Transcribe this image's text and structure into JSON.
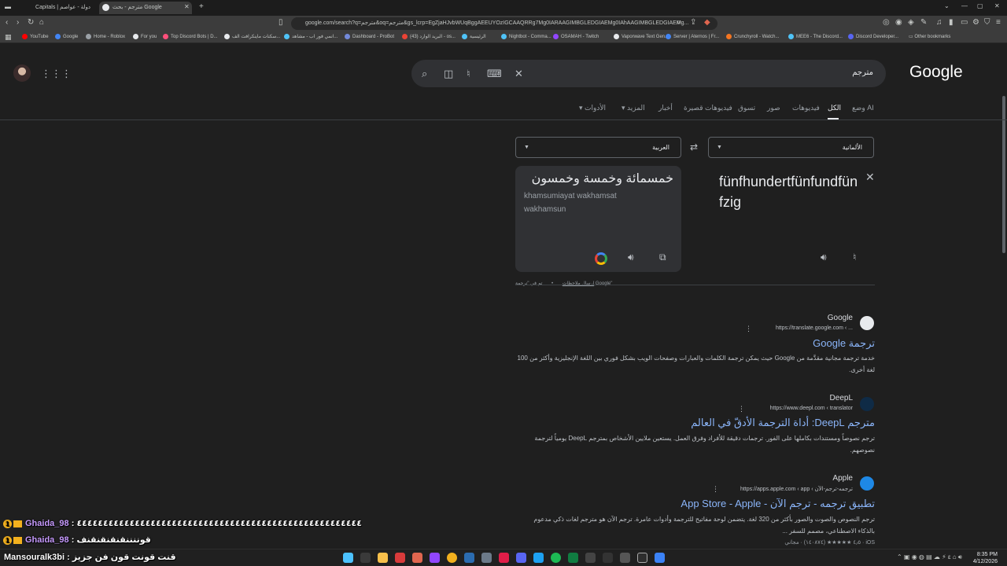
{
  "browser": {
    "tabs": [
      {
        "label": "Capitals | دولة - عواصم",
        "active": false
      },
      {
        "label": "مترجم - بحث Google",
        "active": true
      }
    ],
    "url": "google.com/search?q=مترجم&oq=مترجم&gs_lcrp=EgZjaHJvbWUqBggAEEUYOzIGCAAQRRg7Mg0IARAAGIMBGLEDGIAEMg0IAhAAGIMBGLEDGIAEMg...",
    "bookmarks": [
      {
        "label": "YouTube",
        "color": "#ff0000"
      },
      {
        "label": "Google",
        "color": "#4285f4"
      },
      {
        "label": "Home - Roblox",
        "color": "#9aa0a6"
      },
      {
        "label": "For you",
        "color": "#e8eaed"
      },
      {
        "label": "Top Discord Bots | D...",
        "color": "#ff4f7b"
      },
      {
        "label": "سكنات ماينكرافت الف...",
        "color": "#e8eaed"
      },
      {
        "label": "انمي فور اب - مشاهد...",
        "color": "#4fc3f7"
      },
      {
        "label": "Dashboard - ProBot",
        "color": "#7289da"
      },
      {
        "label": "(43) البريد الوارد - os...",
        "color": "#ea4335"
      },
      {
        "label": "الرئيسية",
        "color": "#4fc3f7"
      },
      {
        "label": "Nightbot - Comma...",
        "color": "#4fc3f7"
      },
      {
        "label": "OSAMAH - Twitch",
        "color": "#9146ff"
      },
      {
        "label": "Vaporwave Text Gen...",
        "color": "#e8eaed"
      },
      {
        "label": "Server | Aternos | Fr...",
        "color": "#4285f4"
      },
      {
        "label": "Crunchyroll - Watch...",
        "color": "#f47521"
      },
      {
        "label": "MEE6 - The Discord...",
        "color": "#4fc3f7"
      },
      {
        "label": "Discord Developer...",
        "color": "#5865f2"
      }
    ],
    "other_bookmarks": "Other bookmarks"
  },
  "google": {
    "logo": "Google",
    "query": "مترجم",
    "nav_tabs": [
      "وضع AI",
      "الكل",
      "فيديوهات",
      "صور",
      "تسوق",
      "فيديوهات قصيرة",
      "أخبار",
      "المزيد",
      "الأدوات"
    ]
  },
  "translator": {
    "target_lang": "العربية",
    "source_lang": "الألمانية",
    "output_text": "خمسمائة وخمسة وخمسون",
    "transliteration": "khamsumiayat wakhamsat wakhamsun",
    "input_text": "fünfhundertfünfundfünfzig",
    "feedback_powered": "تم في \"ترجمة Google\"",
    "feedback_link": "إرسال ملاحظات"
  },
  "results": [
    {
      "site": "Google",
      "url": "https://translate.google.com ‹ ...",
      "title": "ترجمة Google",
      "snippet": "خدمة ترجمة مجانية مقدَّمة من Google حيث يمكن ترجمة الكلمات والعبارات وصفحات الويب بشكل فوري بين اللغة الإنجليزية وأكثر من 100 لغة أخرى."
    },
    {
      "site": "DeepL",
      "url": "https://www.deepl.com ‹ translator",
      "title": "مترجم DeepL: أداة الترجمة الأدقّ في العالم",
      "snippet": "ترجم نصوصاً ومستندات بكاملها على الفور. ترجمات دقيقة للأفراد وفرق العمل. يستعين ملايين الأشخاص بمترجم DeepL يومياً لترجمة نصوصهم."
    },
    {
      "site": "Apple",
      "url": "https://apps.apple.com ‹ app ‹ ترجمه-ترجم-الآن",
      "title": "تطبيق ترجمه - ترجم الآن - App Store - Apple",
      "snippet": "ترجم النصوص والصوت والصور بأكثر من 320 لغة. يتضمن لوحة مفاتيح للترجمة وأدوات عامرة. ترجم الآن هو مترجم لغات ذكي مدعوم بالذكاء الاصطناعي، مصمم للسفر ...",
      "rating": "٤٫٥ ★★★★★ (١٤٠٨٧٤) · مجاني · iOS"
    }
  ],
  "chat": [
    {
      "name": "Ghaida_98",
      "message": ": ٤٤٤٤٤٤٤٤٤٤٤٤٤٤٤٤٤٤٤٤٤٤٤٤٤٤٤٤٤٤٤٤٤٤٤٤٤٤٤٤٤٤٤٤٤٤٤٤٤٤٤٤٤٤"
    },
    {
      "name": "Ghaida_98",
      "message": ": قوننننقنقنقنقنف"
    },
    {
      "name": "Mansouralk3bi",
      "message": ": قنت قونت قون فن جزيز"
    }
  ],
  "taskbar": {
    "time": "8:35 PM",
    "date": "4/12/2026"
  }
}
